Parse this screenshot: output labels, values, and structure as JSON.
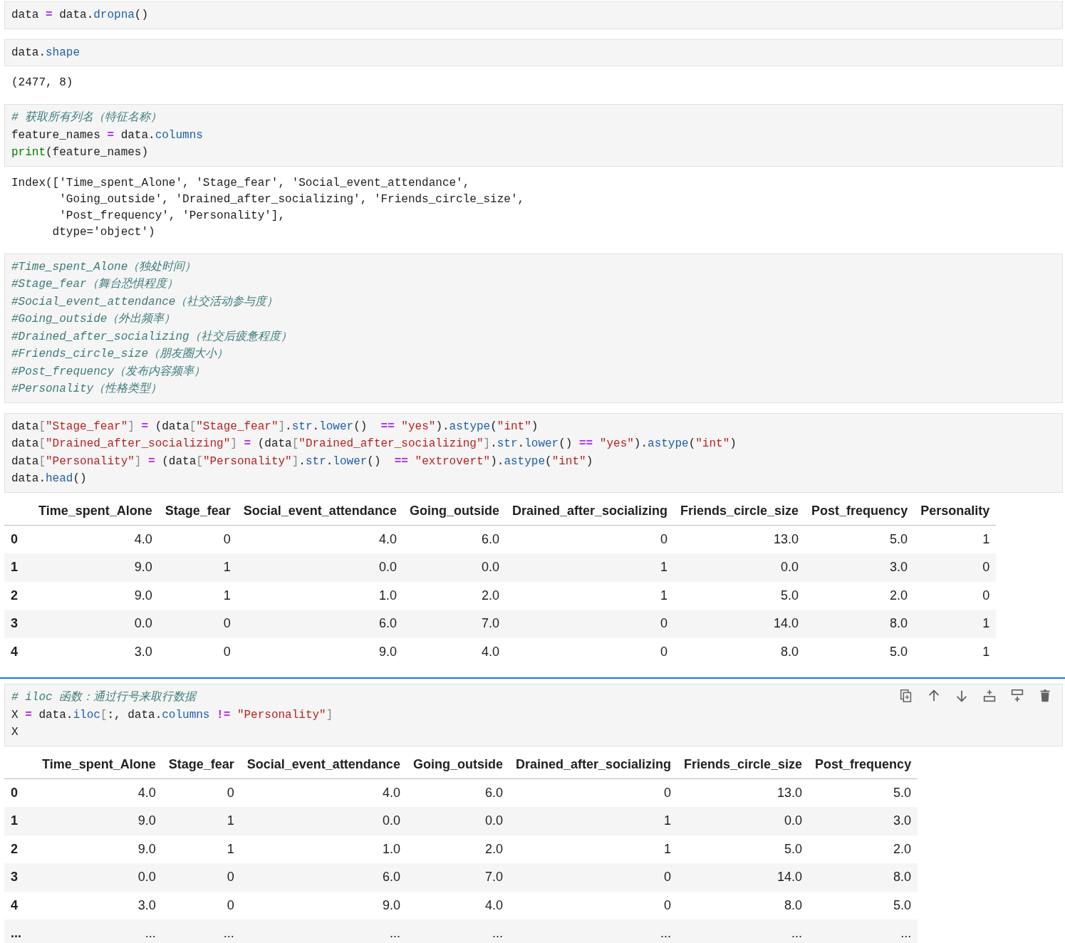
{
  "cells": [
    {
      "selected": false,
      "source": [
        [
          {
            "kind": "n",
            "text": "data "
          },
          {
            "kind": "o",
            "text": "="
          },
          {
            "kind": "n",
            "text": " data."
          },
          {
            "kind": "a",
            "text": "dropna"
          },
          {
            "kind": "n",
            "text": "()"
          }
        ]
      ]
    },
    {
      "selected": false,
      "source": [
        [
          {
            "kind": "n",
            "text": "data."
          },
          {
            "kind": "a",
            "text": "shape"
          }
        ]
      ],
      "output": {
        "kind": "text",
        "lines": [
          "(2477, 8)"
        ]
      }
    },
    {
      "selected": false,
      "source": [
        [
          {
            "kind": "c",
            "text": "# 获取所有列名（特征名称）"
          }
        ],
        [
          {
            "kind": "n",
            "text": "feature_names "
          },
          {
            "kind": "o",
            "text": "="
          },
          {
            "kind": "n",
            "text": " data."
          },
          {
            "kind": "a",
            "text": "columns"
          }
        ],
        [
          {
            "kind": "f",
            "text": "print"
          },
          {
            "kind": "n",
            "text": "(feature_names)"
          }
        ]
      ],
      "output": {
        "kind": "text",
        "lines": [
          "Index(['Time_spent_Alone', 'Stage_fear', 'Social_event_attendance',",
          "       'Going_outside', 'Drained_after_socializing', 'Friends_circle_size',",
          "       'Post_frequency', 'Personality'],",
          "      dtype='object')"
        ]
      }
    },
    {
      "selected": false,
      "source": [
        [
          {
            "kind": "c",
            "text": "#Time_spent_Alone（独处时间）"
          }
        ],
        [
          {
            "kind": "c",
            "text": "#Stage_fear（舞台恐惧程度）"
          }
        ],
        [
          {
            "kind": "c",
            "text": "#Social_event_attendance（社交活动参与度）"
          }
        ],
        [
          {
            "kind": "c",
            "text": "#Going_outside（外出频率）"
          }
        ],
        [
          {
            "kind": "c",
            "text": "#Drained_after_socializing（社交后疲惫程度）"
          }
        ],
        [
          {
            "kind": "c",
            "text": "#Friends_circle_size（朋友圈大小）"
          }
        ],
        [
          {
            "kind": "c",
            "text": "#Post_frequency（发布内容频率）"
          }
        ],
        [
          {
            "kind": "c",
            "text": "#Personality（性格类型）"
          }
        ]
      ]
    },
    {
      "selected": false,
      "source": [
        [
          {
            "kind": "n",
            "text": "data"
          },
          {
            "kind": "b",
            "text": "["
          },
          {
            "kind": "s",
            "text": "\"Stage_fear\""
          },
          {
            "kind": "b",
            "text": "] "
          },
          {
            "kind": "o",
            "text": "="
          },
          {
            "kind": "n",
            "text": " (data"
          },
          {
            "kind": "b",
            "text": "["
          },
          {
            "kind": "s",
            "text": "\"Stage_fear\""
          },
          {
            "kind": "b",
            "text": "]"
          },
          {
            "kind": "n",
            "text": "."
          },
          {
            "kind": "a",
            "text": "str"
          },
          {
            "kind": "n",
            "text": "."
          },
          {
            "kind": "a",
            "text": "lower"
          },
          {
            "kind": "n",
            "text": "()  "
          },
          {
            "kind": "o",
            "text": "== "
          },
          {
            "kind": "s",
            "text": "\"yes\""
          },
          {
            "kind": "n",
            "text": ")."
          },
          {
            "kind": "a",
            "text": "astype"
          },
          {
            "kind": "n",
            "text": "("
          },
          {
            "kind": "s",
            "text": "\"int\""
          },
          {
            "kind": "n",
            "text": ")"
          }
        ],
        [
          {
            "kind": "n",
            "text": "data"
          },
          {
            "kind": "b",
            "text": "["
          },
          {
            "kind": "s",
            "text": "\"Drained_after_socializing\""
          },
          {
            "kind": "b",
            "text": "] "
          },
          {
            "kind": "o",
            "text": "="
          },
          {
            "kind": "n",
            "text": " (data"
          },
          {
            "kind": "b",
            "text": "["
          },
          {
            "kind": "s",
            "text": "\"Drained_after_socializing\""
          },
          {
            "kind": "b",
            "text": "]"
          },
          {
            "kind": "n",
            "text": "."
          },
          {
            "kind": "a",
            "text": "str"
          },
          {
            "kind": "n",
            "text": "."
          },
          {
            "kind": "a",
            "text": "lower"
          },
          {
            "kind": "n",
            "text": "() "
          },
          {
            "kind": "o",
            "text": "== "
          },
          {
            "kind": "s",
            "text": "\"yes\""
          },
          {
            "kind": "n",
            "text": ")."
          },
          {
            "kind": "a",
            "text": "astype"
          },
          {
            "kind": "n",
            "text": "("
          },
          {
            "kind": "s",
            "text": "\"int\""
          },
          {
            "kind": "n",
            "text": ")"
          }
        ],
        [
          {
            "kind": "n",
            "text": "data"
          },
          {
            "kind": "b",
            "text": "["
          },
          {
            "kind": "s",
            "text": "\"Personality\""
          },
          {
            "kind": "b",
            "text": "] "
          },
          {
            "kind": "o",
            "text": "="
          },
          {
            "kind": "n",
            "text": " (data"
          },
          {
            "kind": "b",
            "text": "["
          },
          {
            "kind": "s",
            "text": "\"Personality\""
          },
          {
            "kind": "b",
            "text": "]"
          },
          {
            "kind": "n",
            "text": "."
          },
          {
            "kind": "a",
            "text": "str"
          },
          {
            "kind": "n",
            "text": "."
          },
          {
            "kind": "a",
            "text": "lower"
          },
          {
            "kind": "n",
            "text": "()  "
          },
          {
            "kind": "o",
            "text": "== "
          },
          {
            "kind": "s",
            "text": "\"extrovert\""
          },
          {
            "kind": "n",
            "text": ")."
          },
          {
            "kind": "a",
            "text": "astype"
          },
          {
            "kind": "n",
            "text": "("
          },
          {
            "kind": "s",
            "text": "\"int\""
          },
          {
            "kind": "n",
            "text": ")"
          }
        ],
        [
          {
            "kind": "n",
            "text": "data."
          },
          {
            "kind": "a",
            "text": "head"
          },
          {
            "kind": "n",
            "text": "()"
          }
        ]
      ],
      "output": {
        "kind": "table",
        "columns": [
          "",
          "Time_spent_Alone",
          "Stage_fear",
          "Social_event_attendance",
          "Going_outside",
          "Drained_after_socializing",
          "Friends_circle_size",
          "Post_frequency",
          "Personality"
        ],
        "rows": [
          [
            "0",
            "4.0",
            "0",
            "4.0",
            "6.0",
            "0",
            "13.0",
            "5.0",
            "1"
          ],
          [
            "1",
            "9.0",
            "1",
            "0.0",
            "0.0",
            "1",
            "0.0",
            "3.0",
            "0"
          ],
          [
            "2",
            "9.0",
            "1",
            "1.0",
            "2.0",
            "1",
            "5.0",
            "2.0",
            "0"
          ],
          [
            "3",
            "0.0",
            "0",
            "6.0",
            "7.0",
            "0",
            "14.0",
            "8.0",
            "1"
          ],
          [
            "4",
            "3.0",
            "0",
            "9.0",
            "4.0",
            "0",
            "8.0",
            "5.0",
            "1"
          ]
        ]
      }
    },
    {
      "selected": true,
      "source": [
        [
          {
            "kind": "c",
            "text": "# iloc 函数：通过行号来取行数据"
          }
        ],
        [
          {
            "kind": "n",
            "text": "X "
          },
          {
            "kind": "o",
            "text": "="
          },
          {
            "kind": "n",
            "text": " data."
          },
          {
            "kind": "a",
            "text": "iloc"
          },
          {
            "kind": "b",
            "text": "["
          },
          {
            "kind": "n",
            "text": ":, data."
          },
          {
            "kind": "a",
            "text": "columns "
          },
          {
            "kind": "o",
            "text": "!= "
          },
          {
            "kind": "s",
            "text": "\"Personality\""
          },
          {
            "kind": "b",
            "text": "]"
          }
        ],
        [
          {
            "kind": "n",
            "text": "X"
          }
        ]
      ],
      "output": {
        "kind": "table",
        "columns": [
          "",
          "Time_spent_Alone",
          "Stage_fear",
          "Social_event_attendance",
          "Going_outside",
          "Drained_after_socializing",
          "Friends_circle_size",
          "Post_frequency"
        ],
        "rows": [
          [
            "0",
            "4.0",
            "0",
            "4.0",
            "6.0",
            "0",
            "13.0",
            "5.0"
          ],
          [
            "1",
            "9.0",
            "1",
            "0.0",
            "0.0",
            "1",
            "0.0",
            "3.0"
          ],
          [
            "2",
            "9.0",
            "1",
            "1.0",
            "2.0",
            "1",
            "5.0",
            "2.0"
          ],
          [
            "3",
            "0.0",
            "0",
            "6.0",
            "7.0",
            "0",
            "14.0",
            "8.0"
          ],
          [
            "4",
            "3.0",
            "0",
            "9.0",
            "4.0",
            "0",
            "8.0",
            "5.0"
          ],
          [
            "...",
            "...",
            "...",
            "...",
            "...",
            "...",
            "...",
            "..."
          ]
        ]
      }
    }
  ]
}
